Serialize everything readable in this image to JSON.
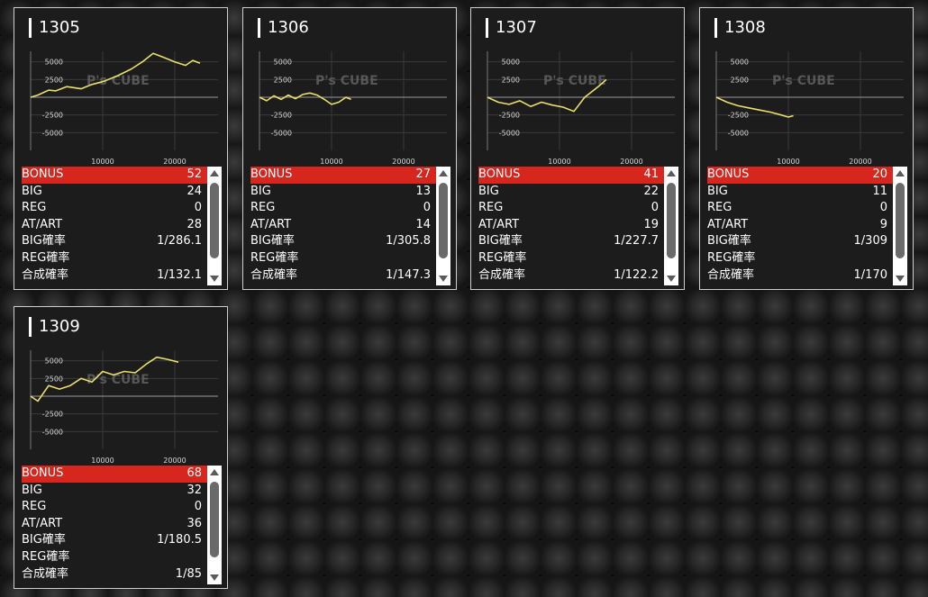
{
  "machines": [
    {
      "id": "1305",
      "stats": [
        {
          "label": "BONUS",
          "value": "52"
        },
        {
          "label": "BIG",
          "value": "24"
        },
        {
          "label": "REG",
          "value": "0"
        },
        {
          "label": "AT/ART",
          "value": "28"
        },
        {
          "label": "BIG確率",
          "value": "1/286.1"
        },
        {
          "label": "REG確率",
          "value": ""
        },
        {
          "label": "合成確率",
          "value": "1/132.1"
        }
      ],
      "chart_data": {
        "type": "line",
        "x": [
          0,
          1000,
          2500,
          3500,
          5000,
          7000,
          8500,
          10000,
          12000,
          14000,
          15500,
          17000,
          18500,
          20000,
          21500,
          22500,
          23500
        ],
        "y": [
          0,
          300,
          1000,
          900,
          1500,
          1200,
          1800,
          2200,
          3000,
          4000,
          5000,
          6200,
          5600,
          5000,
          4500,
          5200,
          4800
        ],
        "xticks": [
          "10000",
          "20000"
        ],
        "yticks": [
          "5000",
          "2500",
          "-2500",
          "-5000"
        ],
        "xlim": [
          0,
          26000
        ],
        "ylim": [
          -7500,
          7500
        ]
      }
    },
    {
      "id": "1306",
      "stats": [
        {
          "label": "BONUS",
          "value": "27"
        },
        {
          "label": "BIG",
          "value": "13"
        },
        {
          "label": "REG",
          "value": "0"
        },
        {
          "label": "AT/ART",
          "value": "14"
        },
        {
          "label": "BIG確率",
          "value": "1/305.8"
        },
        {
          "label": "REG確率",
          "value": ""
        },
        {
          "label": "合成確率",
          "value": "1/147.3"
        }
      ],
      "chart_data": {
        "type": "line",
        "x": [
          0,
          1000,
          2000,
          3000,
          4000,
          5000,
          6000,
          7000,
          8000,
          9000,
          10000,
          11000,
          12000,
          12700
        ],
        "y": [
          0,
          -500,
          200,
          -300,
          300,
          -200,
          400,
          600,
          300,
          -300,
          -1000,
          -700,
          0,
          -300
        ],
        "xticks": [
          "10000",
          "20000"
        ],
        "yticks": [
          "5000",
          "2500",
          "-2500",
          "-5000"
        ],
        "xlim": [
          0,
          26000
        ],
        "ylim": [
          -7500,
          7500
        ]
      }
    },
    {
      "id": "1307",
      "stats": [
        {
          "label": "BONUS",
          "value": "41"
        },
        {
          "label": "BIG",
          "value": "22"
        },
        {
          "label": "REG",
          "value": "0"
        },
        {
          "label": "AT/ART",
          "value": "19"
        },
        {
          "label": "BIG確率",
          "value": "1/227.7"
        },
        {
          "label": "REG確率",
          "value": ""
        },
        {
          "label": "合成確率",
          "value": "1/122.2"
        }
      ],
      "chart_data": {
        "type": "line",
        "x": [
          0,
          1500,
          3000,
          4500,
          6000,
          7500,
          9000,
          10500,
          12000,
          13500,
          14500,
          15500,
          16500
        ],
        "y": [
          0,
          -700,
          -1000,
          -500,
          -1300,
          -700,
          -1100,
          -1400,
          -2000,
          0,
          800,
          1600,
          2500
        ],
        "xticks": [
          "10000",
          "20000"
        ],
        "yticks": [
          "5000",
          "2500",
          "-2500",
          "-5000"
        ],
        "xlim": [
          0,
          26000
        ],
        "ylim": [
          -7500,
          7500
        ]
      }
    },
    {
      "id": "1308",
      "stats": [
        {
          "label": "BONUS",
          "value": "20"
        },
        {
          "label": "BIG",
          "value": "11"
        },
        {
          "label": "REG",
          "value": "0"
        },
        {
          "label": "AT/ART",
          "value": "9"
        },
        {
          "label": "BIG確率",
          "value": "1/309"
        },
        {
          "label": "REG確率",
          "value": ""
        },
        {
          "label": "合成確率",
          "value": "1/170"
        }
      ],
      "chart_data": {
        "type": "line",
        "x": [
          0,
          1500,
          3000,
          4500,
          6000,
          7500,
          9000,
          10000,
          10700
        ],
        "y": [
          0,
          -700,
          -1200,
          -1500,
          -1800,
          -2100,
          -2500,
          -2800,
          -2600
        ],
        "xticks": [
          "10000",
          "20000"
        ],
        "yticks": [
          "5000",
          "2500",
          "-2500",
          "-5000"
        ],
        "xlim": [
          0,
          26000
        ],
        "ylim": [
          -7500,
          7500
        ]
      }
    },
    {
      "id": "1309",
      "stats": [
        {
          "label": "BONUS",
          "value": "68"
        },
        {
          "label": "BIG",
          "value": "32"
        },
        {
          "label": "REG",
          "value": "0"
        },
        {
          "label": "AT/ART",
          "value": "36"
        },
        {
          "label": "BIG確率",
          "value": "1/180.5"
        },
        {
          "label": "REG確率",
          "value": ""
        },
        {
          "label": "合成確率",
          "value": "1/85"
        }
      ],
      "chart_data": {
        "type": "line",
        "x": [
          0,
          1000,
          2500,
          4000,
          5500,
          7000,
          8500,
          10000,
          11500,
          13000,
          14500,
          16000,
          17500,
          19000,
          20500
        ],
        "y": [
          0,
          -700,
          1500,
          1000,
          1500,
          2500,
          2000,
          3500,
          3000,
          3500,
          3300,
          4500,
          5500,
          5200,
          4800
        ],
        "xticks": [
          "10000",
          "20000"
        ],
        "yticks": [
          "5000",
          "2500",
          "-2500",
          "-5000"
        ],
        "xlim": [
          0,
          26000
        ],
        "ylim": [
          -7500,
          7500
        ]
      }
    }
  ],
  "watermark": "P's CUBE",
  "colors": {
    "line": "#e8e06a",
    "bonus_row": "#d7261e",
    "card_bg": "#1c1c1c",
    "card_border": "#cfcfcf"
  }
}
